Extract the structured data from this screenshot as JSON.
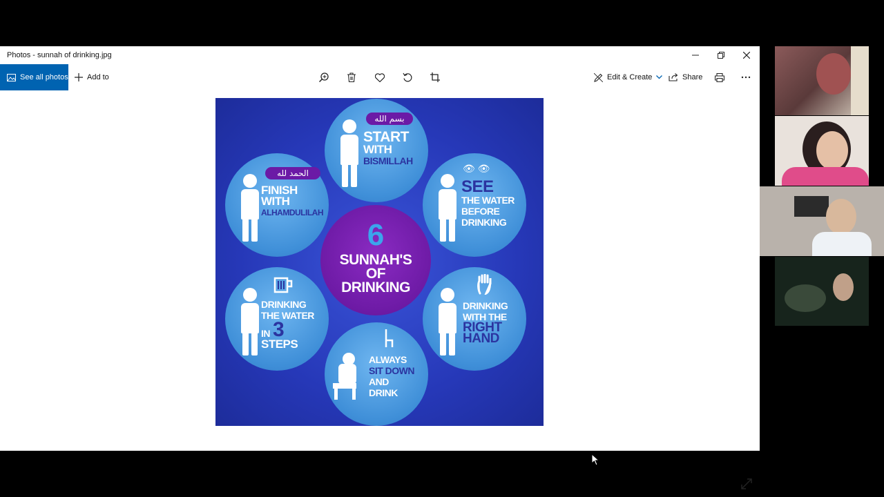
{
  "window": {
    "title": "Photos - sunnah of drinking.jpg"
  },
  "toolbar": {
    "see_all_photos": "See all photos",
    "add_to": "Add to",
    "edit_create": "Edit & Create",
    "share": "Share"
  },
  "poster": {
    "center_number": "6",
    "center_lines": [
      "SUNNAH'S",
      "OF",
      "DRINKING"
    ],
    "items": [
      {
        "arabic": "بسم الله",
        "lines": [
          "START",
          "WITH",
          "BISMILLAH"
        ]
      },
      {
        "arabic": "الحمد لله",
        "lines": [
          "FINISH",
          "WITH",
          "ALHAMDULILAH"
        ]
      },
      {
        "eyes": "👁 👁",
        "lines": [
          "SEE",
          "THE WATER",
          "BEFORE",
          "DRINKING"
        ]
      },
      {
        "lines": [
          "DRINKING",
          "THE WATER",
          "IN",
          "3",
          "STEPS"
        ]
      },
      {
        "lines": [
          "DRINKING",
          "WITH THE",
          "RIGHT",
          "HAND"
        ]
      },
      {
        "lines": [
          "ALWAYS",
          "SIT DOWN",
          "AND",
          "DRINK"
        ]
      }
    ]
  },
  "colors": {
    "accent": "#0063b1",
    "poster_bg": "#2638b8",
    "bubble": "#3f8fd8",
    "center": "#6d1aa5"
  }
}
